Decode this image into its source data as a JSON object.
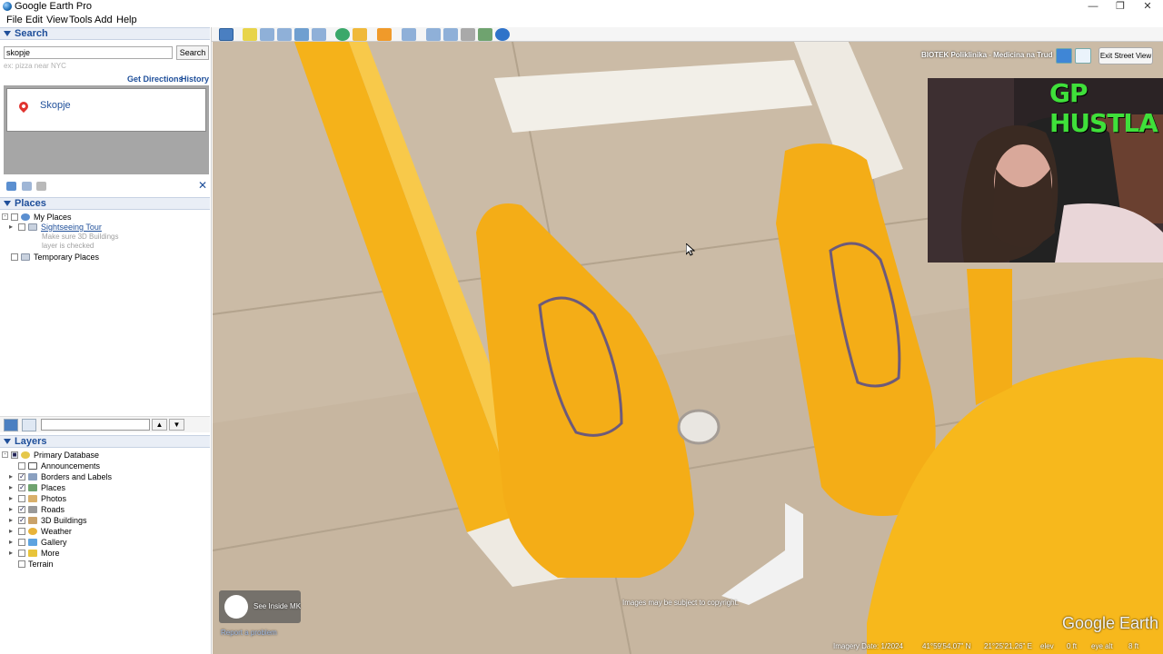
{
  "window": {
    "title": "Google Earth Pro"
  },
  "menu": [
    "File",
    "Edit",
    "View",
    "Tools",
    "Add",
    "Help"
  ],
  "search": {
    "header": "Search",
    "query": "skopje",
    "button": "Search",
    "hint": "ex: pizza near NYC",
    "get_directions": "Get Directions",
    "history": "History",
    "result": "Skopje"
  },
  "places": {
    "header": "Places",
    "my_places": "My Places",
    "sightseeing": "Sightseeing Tour",
    "hint1": "Make sure 3D Buildings",
    "hint2": "layer is checked",
    "temporary": "Temporary Places"
  },
  "layers": {
    "header": "Layers",
    "items": [
      {
        "label": "Primary Database",
        "checked": false
      },
      {
        "label": "Announcements",
        "checked": false
      },
      {
        "label": "Borders and Labels",
        "checked": true
      },
      {
        "label": "Places",
        "checked": true
      },
      {
        "label": "Photos",
        "checked": false
      },
      {
        "label": "Roads",
        "checked": true
      },
      {
        "label": "3D Buildings",
        "checked": true
      },
      {
        "label": "Weather",
        "checked": false
      },
      {
        "label": "Gallery",
        "checked": false
      },
      {
        "label": "More",
        "checked": false
      },
      {
        "label": "Terrain",
        "checked": false
      }
    ]
  },
  "streetview": {
    "place_name": "BIOTEK Poliklinika - Medicina na Trud",
    "exit": "Exit Street View",
    "attribution_btn": "See Inside MK",
    "report": "Report a problem",
    "copyright": "Images may be subject to copyright.",
    "logo": "Google Earth"
  },
  "status": {
    "imagery_date": "Imagery Date: 1/2024",
    "lat": "41°59'54.07\" N",
    "lon": "21°25'21.26\" E",
    "elev_label": "elev",
    "elev": "0 ft",
    "eye_label": "eye alt",
    "eye": "8 ft"
  },
  "webcam": {
    "banner": "GP HUSTLA"
  }
}
